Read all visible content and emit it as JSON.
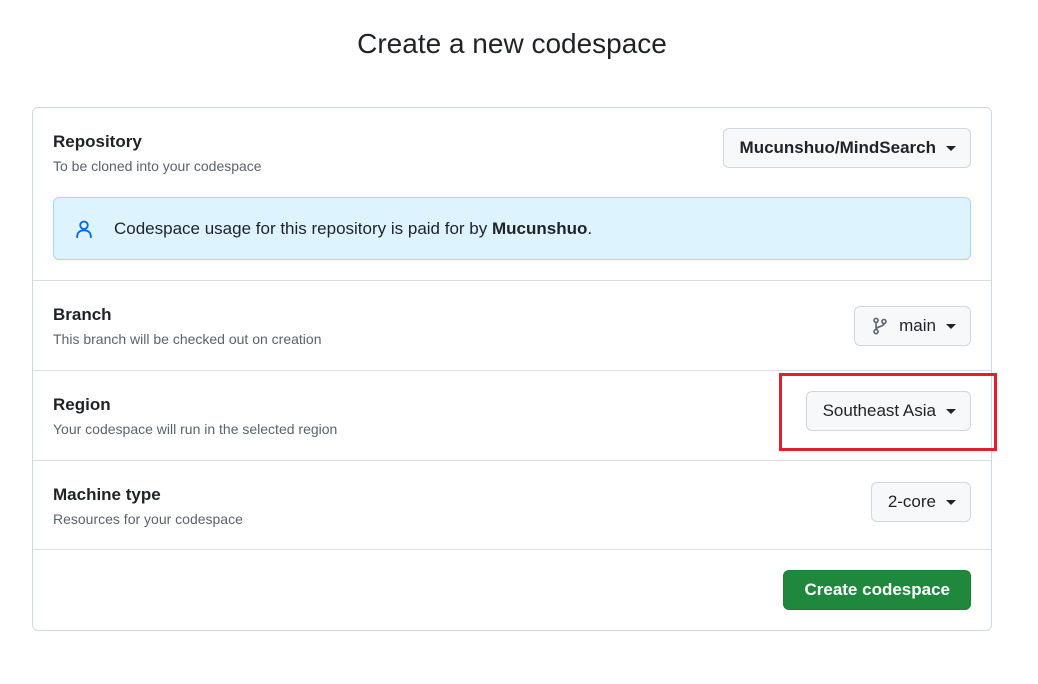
{
  "page": {
    "title": "Create a new codespace"
  },
  "repository": {
    "label": "Repository",
    "description": "To be cloned into your codespace",
    "selected": "Mucunshuo/MindSearch",
    "banner_prefix": "Codespace usage for this repository is paid for by ",
    "banner_owner": "Mucunshuo",
    "banner_suffix": "."
  },
  "branch": {
    "label": "Branch",
    "description": "This branch will be checked out on creation",
    "selected": "main"
  },
  "region": {
    "label": "Region",
    "description": "Your codespace will run in the selected region",
    "selected": "Southeast Asia"
  },
  "machine": {
    "label": "Machine type",
    "description": "Resources for your codespace",
    "selected": "2-core"
  },
  "footer": {
    "create_label": "Create codespace"
  },
  "colors": {
    "accent_green": "#1f883d",
    "banner_bg": "#ddf4ff",
    "highlight_red": "#e0202a",
    "icon_blue": "#0969da"
  },
  "icons": {
    "banner": "person-icon",
    "branch": "git-branch-icon",
    "dropdown": "triangle-down-icon"
  }
}
